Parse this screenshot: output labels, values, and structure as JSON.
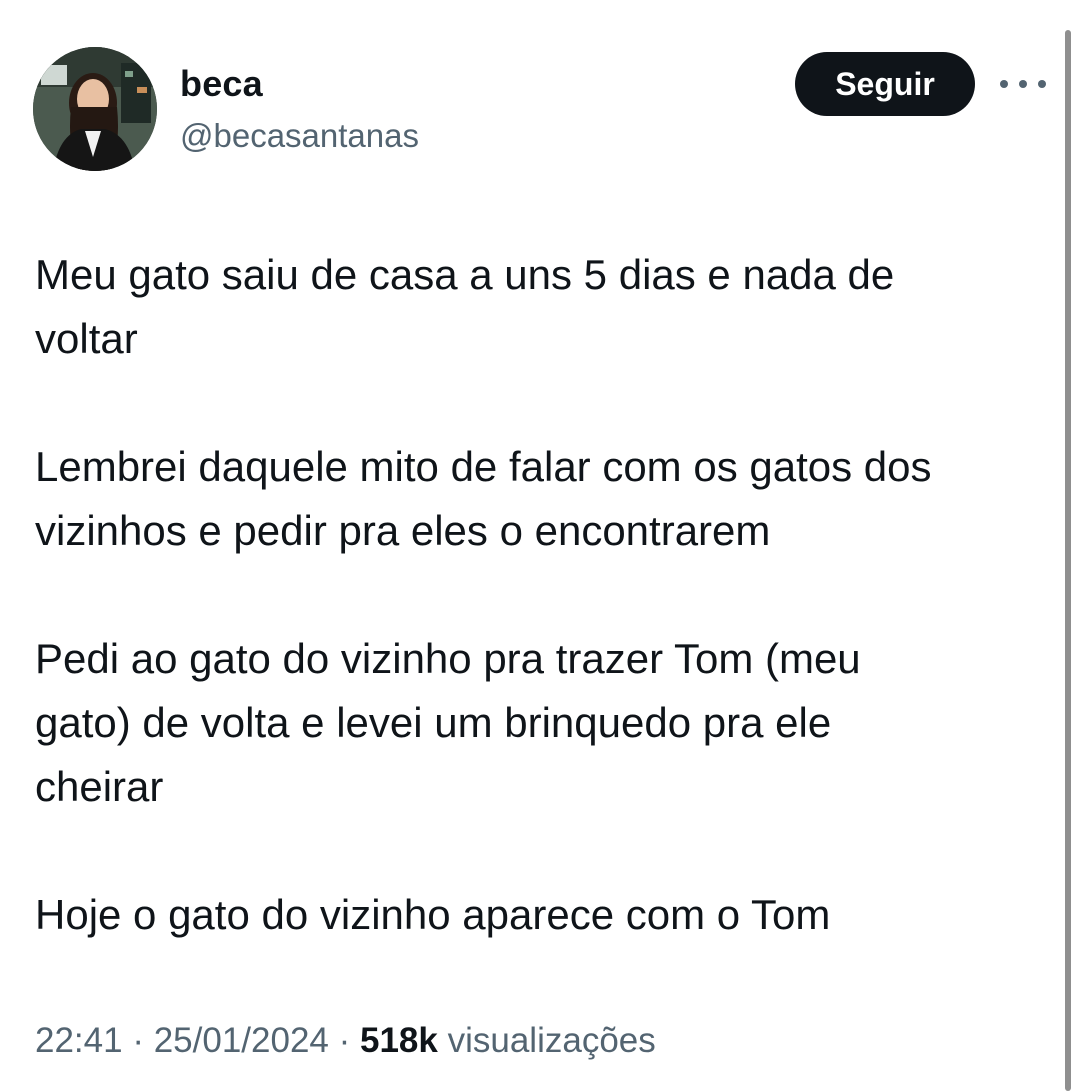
{
  "author": {
    "display_name": "beca",
    "handle": "@becasantanas",
    "avatar_icon": "profile-photo"
  },
  "actions": {
    "follow_label": "Seguir",
    "more_icon": "more-horizontal-icon"
  },
  "tweet": {
    "paragraphs": [
      "Meu gato saiu de casa a uns 5 dias e nada de\nvoltar",
      "Lembrei daquele mito de falar com os gatos dos\nvizinhos e pedir pra eles o encontrarem",
      "Pedi ao gato do vizinho pra trazer Tom (meu\ngato) de volta e levei um brinquedo pra ele\ncheirar",
      "Hoje o gato do vizinho aparece com o Tom"
    ]
  },
  "meta": {
    "time": "22:41",
    "separator": " · ",
    "date": "25/01/2024",
    "views_count": "518k",
    "views_label": "visualizações"
  },
  "colors": {
    "text_primary": "#0f1419",
    "text_secondary": "#536471",
    "button_bg": "#0f1419",
    "button_text": "#ffffff"
  }
}
